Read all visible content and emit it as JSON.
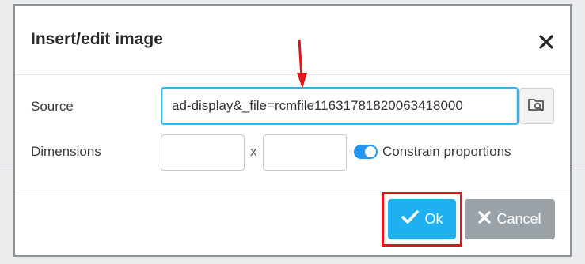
{
  "dialog": {
    "title": "Insert/edit image",
    "source": {
      "label": "Source",
      "value": "ad-display&_file=rcmfile11631781820063418000"
    },
    "dimensions": {
      "label": "Dimensions",
      "width_value": "",
      "height_value": "",
      "separator": "x",
      "constrain_label": "Constrain proportions",
      "constrain_on": true
    },
    "buttons": {
      "ok_label": "Ok",
      "cancel_label": "Cancel"
    }
  },
  "icons": {
    "close": "close-icon",
    "browse": "browse-icon",
    "ok": "check-icon",
    "cancel": "x-icon"
  },
  "colors": {
    "accent": "#1fb0f2",
    "toggle": "#2196f3",
    "cancel": "#9aa2a8",
    "annotation": "#e3141c"
  }
}
